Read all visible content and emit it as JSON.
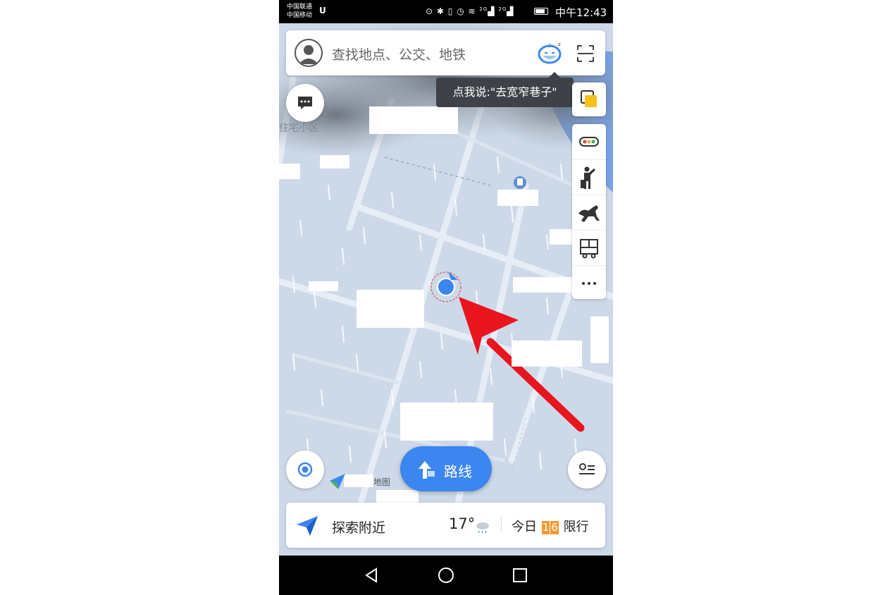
{
  "status_bar": {
    "carrier1": "中国联通",
    "carrier2": "中国移动",
    "network1": "2G",
    "network2": "2G",
    "time": "中午12:43"
  },
  "search": {
    "placeholder": "查找地点、公交、地铁"
  },
  "voice_tip": "点我说:\"去宽窄巷子\"",
  "map": {
    "place_label": "住宅小区",
    "logo_label": "地图"
  },
  "tools": [
    "traffic-icon",
    "taxi-icon",
    "ride-icon",
    "bus-icon",
    "more-icon"
  ],
  "route_button": {
    "label": "路线"
  },
  "bottom_bar": {
    "explore_label": "探索附近",
    "temperature": "17°",
    "today_label": "今日",
    "plate1": "1",
    "plate2": "6",
    "restriction_label": "限行"
  },
  "colors": {
    "accent": "#3c86f0",
    "annotation_arrow": "#e8141e",
    "plate": "#f29a2e"
  }
}
